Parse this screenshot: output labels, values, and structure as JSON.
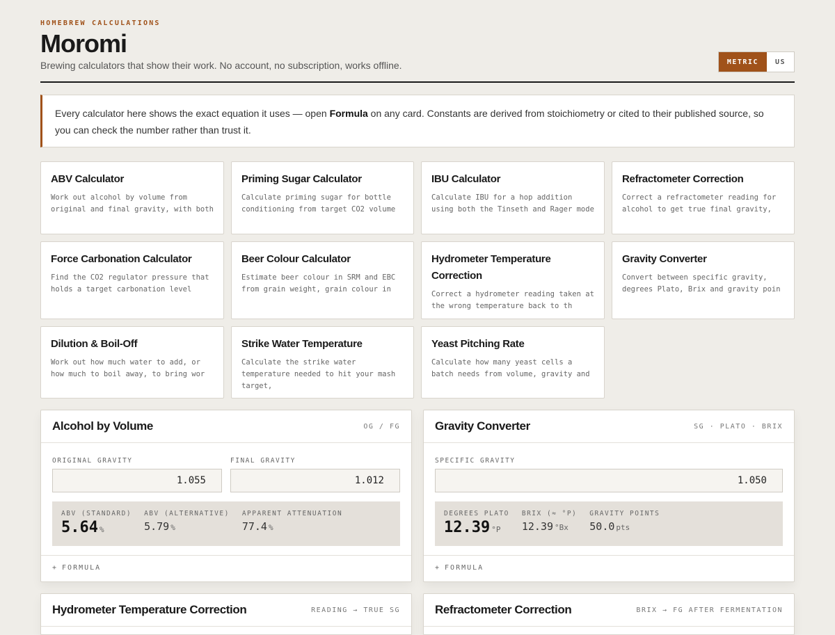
{
  "header": {
    "eyebrow": "HOMEBREW CALCULATIONS",
    "title": "Moromi",
    "subtitle": "Brewing calculators that show their work. No account, no subscription, works offline.",
    "units": [
      {
        "label": "METRIC",
        "active": true
      },
      {
        "label": "US",
        "active": false
      }
    ]
  },
  "notice": {
    "before": "Every calculator here shows the exact equation it uses — open ",
    "strong": "Formula",
    "after": " on any card. Constants are derived from stoichiometry or cited to their published source, so you can check the number rather than trust it."
  },
  "calculators": [
    {
      "title": "ABV Calculator",
      "desc": "Work out alcohol by volume from original and final gravity, with both"
    },
    {
      "title": "Priming Sugar Calculator",
      "desc": "Calculate priming sugar for bottle conditioning from target CO2 volume"
    },
    {
      "title": "IBU Calculator",
      "desc": "Calculate IBU for a hop addition using both the Tinseth and Rager mode"
    },
    {
      "title": "Refractometer Correction",
      "desc": "Correct a refractometer reading for alcohol to get true final gravity,"
    },
    {
      "title": "Force Carbonation Calculator",
      "desc": "Find the CO2 regulator pressure that holds a target carbonation level"
    },
    {
      "title": "Beer Colour Calculator",
      "desc": "Estimate beer colour in SRM and EBC from grain weight, grain colour in"
    },
    {
      "title": "Hydrometer Temperature Correction",
      "desc": "Correct a hydrometer reading taken at the wrong temperature back to th"
    },
    {
      "title": "Gravity Converter",
      "desc": "Convert between specific gravity, degrees Plato, Brix and gravity poin"
    },
    {
      "title": "Dilution & Boil-Off",
      "desc": "Work out how much water to add, or how much to boil away, to bring wor"
    },
    {
      "title": "Strike Water Temperature",
      "desc": "Calculate the strike water temperature needed to hit your mash target,"
    },
    {
      "title": "Yeast Pitching Rate",
      "desc": "Calculate how many yeast cells a batch needs from volume, gravity and"
    }
  ],
  "abv_panel": {
    "title": "Alcohol by Volume",
    "subtitle": "OG / FG",
    "fields": [
      {
        "label": "ORIGINAL GRAVITY",
        "value": "1.055"
      },
      {
        "label": "FINAL GRAVITY",
        "value": "1.012"
      }
    ],
    "results": [
      {
        "label": "ABV (STANDARD)",
        "value": "5.64",
        "unit": "%"
      },
      {
        "label": "ABV (ALTERNATIVE)",
        "value": "5.79",
        "unit": "%"
      },
      {
        "label": "APPARENT ATTENUATION",
        "value": "77.4",
        "unit": "%"
      }
    ],
    "formula_label": "FORMULA"
  },
  "gravity_panel": {
    "title": "Gravity Converter",
    "subtitle": "SG · PLATO · BRIX",
    "fields": [
      {
        "label": "SPECIFIC GRAVITY",
        "value": "1.050"
      }
    ],
    "results": [
      {
        "label": "DEGREES PLATO",
        "value": "12.39",
        "unit": "°P"
      },
      {
        "label": "BRIX (≈ °P)",
        "value": "12.39",
        "unit": "°Bx"
      },
      {
        "label": "GRAVITY POINTS",
        "value": "50.0",
        "unit": "pts"
      }
    ],
    "formula_label": "FORMULA"
  },
  "hydrometer_panel": {
    "title": "Hydrometer Temperature Correction",
    "subtitle": "READING → TRUE SG"
  },
  "refractometer_panel": {
    "title": "Refractometer Correction",
    "subtitle": "BRIX → FG AFTER FERMENTATION"
  }
}
